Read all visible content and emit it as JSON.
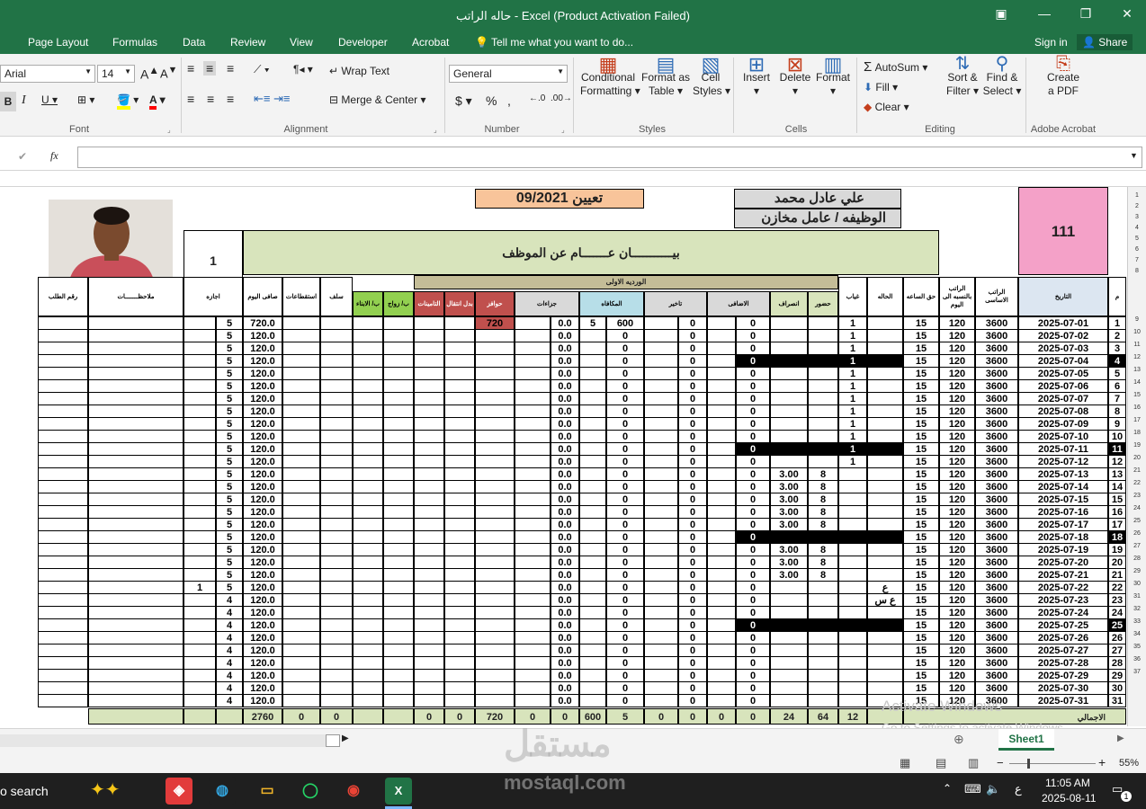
{
  "window": {
    "title": "حاله الراتب - Excel (Product Activation Failed)"
  },
  "menu": [
    "Page Layout",
    "Formulas",
    "Data",
    "Review",
    "View",
    "Developer",
    "Acrobat"
  ],
  "tell_me": "Tell me what you want to do...",
  "sign_in": "Sign in",
  "share": "Share",
  "ribbon": {
    "font_name": "Arial",
    "font_size": "14",
    "number_format": "General",
    "wrap_text": "Wrap Text",
    "merge_center": "Merge & Center",
    "conditional": "Conditional",
    "formatting": "Formatting",
    "format_as": "Format as",
    "table": "Table",
    "cell": "Cell",
    "styles": "Styles",
    "insert": "Insert",
    "delete": "Delete",
    "format": "Format",
    "autosum": "AutoSum",
    "fill": "Fill",
    "clear": "Clear",
    "sort": "Sort &",
    "filter": "Filter",
    "find": "Find &",
    "select": "Select",
    "create": "Create",
    "pdf": "a PDF",
    "groups": {
      "font": "Font",
      "alignment": "Alignment",
      "number": "Number",
      "styles": "Styles",
      "cells": "Cells",
      "editing": "Editing",
      "acrobat": "Adobe Acrobat"
    }
  },
  "formula_bar": {
    "fx": "fx",
    "value": ""
  },
  "sheet": {
    "employee_name": "علي عادل محمد",
    "job": "الوظيفه / عامل مخازن",
    "appointment": "تعيين 09/2021",
    "employee_id": "111",
    "data_title": "بيـــــــــــان عـــــــام عن الموظف",
    "box_one": "1",
    "shift_label": "الورديه الاولى",
    "headers": {
      "m": "م",
      "date": "التاريخ",
      "basic": "الراتب الاساسى",
      "daily": "الراتب بالنسبه الى اليوم",
      "hourly": "حق الساعه",
      "status": "الحاله",
      "absent": "غياب",
      "attend": "حضور",
      "leave": "انصراف",
      "overtime": "الاضافى",
      "late": "تاخير",
      "reward": "المكافاه",
      "penalty": "جزاءات",
      "incentive": "حوافز",
      "allowance": "بدل انتقال",
      "insurance": "التامينات",
      "marriage": "ب/ زواج",
      "kids": "ب/ الابناء",
      "advance": "سلف",
      "deductions": "استقطاعات",
      "net": "صافى اليوم",
      "vacation": "اجازه",
      "notes": "ملاحظـــــــات",
      "request": "رقم الطلب"
    },
    "rows": [
      {
        "n": "1",
        "date": "2025-07-01",
        "absent": "1",
        "attend": "",
        "leave": "",
        "hilite": false,
        "net": "720.0",
        "vac": "5",
        "vac2": "",
        "pen": "0.0",
        "rew": "600",
        "rew2": "5",
        "late": "0",
        "ot": "0",
        "inc": "720",
        "status": ""
      },
      {
        "n": "2",
        "date": "2025-07-02",
        "absent": "1",
        "attend": "",
        "leave": "",
        "hilite": false,
        "net": "120.0",
        "vac": "5",
        "vac2": "",
        "pen": "0.0",
        "rew": "0",
        "rew2": "",
        "late": "0",
        "ot": "0",
        "inc": "",
        "status": ""
      },
      {
        "n": "3",
        "date": "2025-07-03",
        "absent": "1",
        "attend": "",
        "leave": "",
        "hilite": false,
        "net": "120.0",
        "vac": "5",
        "vac2": "",
        "pen": "0.0",
        "rew": "0",
        "rew2": "",
        "late": "0",
        "ot": "0",
        "inc": "",
        "status": ""
      },
      {
        "n": "4",
        "date": "2025-07-04",
        "absent": "1",
        "attend": "",
        "leave": "",
        "hilite": true,
        "net": "120.0",
        "vac": "5",
        "vac2": "",
        "pen": "0.0",
        "rew": "0",
        "rew2": "",
        "late": "0",
        "ot": "0",
        "inc": "",
        "status": ""
      },
      {
        "n": "5",
        "date": "2025-07-05",
        "absent": "1",
        "attend": "",
        "leave": "",
        "hilite": false,
        "net": "120.0",
        "vac": "5",
        "vac2": "",
        "pen": "0.0",
        "rew": "0",
        "rew2": "",
        "late": "0",
        "ot": "0",
        "inc": "",
        "status": ""
      },
      {
        "n": "6",
        "date": "2025-07-06",
        "absent": "1",
        "attend": "",
        "leave": "",
        "hilite": false,
        "net": "120.0",
        "vac": "5",
        "vac2": "",
        "pen": "0.0",
        "rew": "0",
        "rew2": "",
        "late": "0",
        "ot": "0",
        "inc": "",
        "status": ""
      },
      {
        "n": "7",
        "date": "2025-07-07",
        "absent": "1",
        "attend": "",
        "leave": "",
        "hilite": false,
        "net": "120.0",
        "vac": "5",
        "vac2": "",
        "pen": "0.0",
        "rew": "0",
        "rew2": "",
        "late": "0",
        "ot": "0",
        "inc": "",
        "status": ""
      },
      {
        "n": "8",
        "date": "2025-07-08",
        "absent": "1",
        "attend": "",
        "leave": "",
        "hilite": false,
        "net": "120.0",
        "vac": "5",
        "vac2": "",
        "pen": "0.0",
        "rew": "0",
        "rew2": "",
        "late": "0",
        "ot": "0",
        "inc": "",
        "status": ""
      },
      {
        "n": "9",
        "date": "2025-07-09",
        "absent": "1",
        "attend": "",
        "leave": "",
        "hilite": false,
        "net": "120.0",
        "vac": "5",
        "vac2": "",
        "pen": "0.0",
        "rew": "0",
        "rew2": "",
        "late": "0",
        "ot": "0",
        "inc": "",
        "status": ""
      },
      {
        "n": "10",
        "date": "2025-07-10",
        "absent": "1",
        "attend": "",
        "leave": "",
        "hilite": false,
        "net": "120.0",
        "vac": "5",
        "vac2": "",
        "pen": "0.0",
        "rew": "0",
        "rew2": "",
        "late": "0",
        "ot": "0",
        "inc": "",
        "status": ""
      },
      {
        "n": "11",
        "date": "2025-07-11",
        "absent": "1",
        "attend": "",
        "leave": "",
        "hilite": true,
        "net": "120.0",
        "vac": "5",
        "vac2": "",
        "pen": "0.0",
        "rew": "0",
        "rew2": "",
        "late": "0",
        "ot": "0",
        "inc": "",
        "status": ""
      },
      {
        "n": "12",
        "date": "2025-07-12",
        "absent": "1",
        "attend": "",
        "leave": "",
        "hilite": false,
        "net": "120.0",
        "vac": "5",
        "vac2": "",
        "pen": "0.0",
        "rew": "0",
        "rew2": "",
        "late": "0",
        "ot": "0",
        "inc": "",
        "status": ""
      },
      {
        "n": "13",
        "date": "2025-07-13",
        "absent": "",
        "attend": "8",
        "leave": "3.00",
        "hilite": false,
        "net": "120.0",
        "vac": "5",
        "vac2": "",
        "pen": "0.0",
        "rew": "0",
        "rew2": "",
        "late": "0",
        "ot": "0",
        "inc": "",
        "status": ""
      },
      {
        "n": "14",
        "date": "2025-07-14",
        "absent": "",
        "attend": "8",
        "leave": "3.00",
        "hilite": false,
        "net": "120.0",
        "vac": "5",
        "vac2": "",
        "pen": "0.0",
        "rew": "0",
        "rew2": "",
        "late": "0",
        "ot": "0",
        "inc": "",
        "status": ""
      },
      {
        "n": "15",
        "date": "2025-07-15",
        "absent": "",
        "attend": "8",
        "leave": "3.00",
        "hilite": false,
        "net": "120.0",
        "vac": "5",
        "vac2": "",
        "pen": "0.0",
        "rew": "0",
        "rew2": "",
        "late": "0",
        "ot": "0",
        "inc": "",
        "status": ""
      },
      {
        "n": "16",
        "date": "2025-07-16",
        "absent": "",
        "attend": "8",
        "leave": "3.00",
        "hilite": false,
        "net": "120.0",
        "vac": "5",
        "vac2": "",
        "pen": "0.0",
        "rew": "0",
        "rew2": "",
        "late": "0",
        "ot": "0",
        "inc": "",
        "status": ""
      },
      {
        "n": "17",
        "date": "2025-07-17",
        "absent": "",
        "attend": "8",
        "leave": "3.00",
        "hilite": false,
        "net": "120.0",
        "vac": "5",
        "vac2": "",
        "pen": "0.0",
        "rew": "0",
        "rew2": "",
        "late": "0",
        "ot": "0",
        "inc": "",
        "status": ""
      },
      {
        "n": "18",
        "date": "2025-07-18",
        "absent": "",
        "attend": "",
        "leave": "",
        "hilite": true,
        "net": "120.0",
        "vac": "5",
        "vac2": "",
        "pen": "0.0",
        "rew": "0",
        "rew2": "",
        "late": "0",
        "ot": "0",
        "inc": "",
        "status": ""
      },
      {
        "n": "19",
        "date": "2025-07-19",
        "absent": "",
        "attend": "8",
        "leave": "3.00",
        "hilite": false,
        "net": "120.0",
        "vac": "5",
        "vac2": "",
        "pen": "0.0",
        "rew": "0",
        "rew2": "",
        "late": "0",
        "ot": "0",
        "inc": "",
        "status": ""
      },
      {
        "n": "20",
        "date": "2025-07-20",
        "absent": "",
        "attend": "8",
        "leave": "3.00",
        "hilite": false,
        "net": "120.0",
        "vac": "5",
        "vac2": "",
        "pen": "0.0",
        "rew": "0",
        "rew2": "",
        "late": "0",
        "ot": "0",
        "inc": "",
        "status": ""
      },
      {
        "n": "21",
        "date": "2025-07-21",
        "absent": "",
        "attend": "8",
        "leave": "3.00",
        "hilite": false,
        "net": "120.0",
        "vac": "5",
        "vac2": "",
        "pen": "0.0",
        "rew": "0",
        "rew2": "",
        "late": "0",
        "ot": "0",
        "inc": "",
        "status": ""
      },
      {
        "n": "22",
        "date": "2025-07-22",
        "absent": "",
        "attend": "",
        "leave": "",
        "hilite": false,
        "net": "120.0",
        "vac": "5",
        "vac2": "1",
        "pen": "0.0",
        "rew": "0",
        "rew2": "",
        "late": "0",
        "ot": "0",
        "inc": "",
        "status": "ع"
      },
      {
        "n": "23",
        "date": "2025-07-23",
        "absent": "",
        "attend": "",
        "leave": "",
        "hilite": false,
        "net": "120.0",
        "vac": "4",
        "vac2": "",
        "pen": "0.0",
        "rew": "0",
        "rew2": "",
        "late": "0",
        "ot": "0",
        "inc": "",
        "status": "ع س"
      },
      {
        "n": "24",
        "date": "2025-07-24",
        "absent": "",
        "attend": "",
        "leave": "",
        "hilite": false,
        "net": "120.0",
        "vac": "4",
        "vac2": "",
        "pen": "0.0",
        "rew": "0",
        "rew2": "",
        "late": "0",
        "ot": "0",
        "inc": "",
        "status": ""
      },
      {
        "n": "25",
        "date": "2025-07-25",
        "absent": "",
        "attend": "",
        "leave": "",
        "hilite": true,
        "net": "120.0",
        "vac": "4",
        "vac2": "",
        "pen": "0.0",
        "rew": "0",
        "rew2": "",
        "late": "0",
        "ot": "0",
        "inc": "",
        "status": ""
      },
      {
        "n": "26",
        "date": "2025-07-26",
        "absent": "",
        "attend": "",
        "leave": "",
        "hilite": false,
        "net": "120.0",
        "vac": "4",
        "vac2": "",
        "pen": "0.0",
        "rew": "0",
        "rew2": "",
        "late": "0",
        "ot": "0",
        "inc": "",
        "status": ""
      },
      {
        "n": "27",
        "date": "2025-07-27",
        "absent": "",
        "attend": "",
        "leave": "",
        "hilite": false,
        "net": "120.0",
        "vac": "4",
        "vac2": "",
        "pen": "0.0",
        "rew": "0",
        "rew2": "",
        "late": "0",
        "ot": "0",
        "inc": "",
        "status": ""
      },
      {
        "n": "28",
        "date": "2025-07-28",
        "absent": "",
        "attend": "",
        "leave": "",
        "hilite": false,
        "net": "120.0",
        "vac": "4",
        "vac2": "",
        "pen": "0.0",
        "rew": "0",
        "rew2": "",
        "late": "0",
        "ot": "0",
        "inc": "",
        "status": ""
      },
      {
        "n": "29",
        "date": "2025-07-29",
        "absent": "",
        "attend": "",
        "leave": "",
        "hilite": false,
        "net": "120.0",
        "vac": "4",
        "vac2": "",
        "pen": "0.0",
        "rew": "0",
        "rew2": "",
        "late": "0",
        "ot": "0",
        "inc": "",
        "status": ""
      },
      {
        "n": "30",
        "date": "2025-07-30",
        "absent": "",
        "attend": "",
        "leave": "",
        "hilite": false,
        "net": "120.0",
        "vac": "4",
        "vac2": "",
        "pen": "0.0",
        "rew": "0",
        "rew2": "",
        "late": "0",
        "ot": "0",
        "inc": "",
        "status": ""
      },
      {
        "n": "31",
        "date": "2025-07-31",
        "absent": "",
        "attend": "",
        "leave": "",
        "hilite": false,
        "net": "120.0",
        "vac": "4",
        "vac2": "",
        "pen": "0.0",
        "rew": "0",
        "rew2": "",
        "late": "0",
        "ot": "0",
        "inc": "",
        "status": ""
      }
    ],
    "common": {
      "hourly": "15",
      "daily": "120",
      "basic": "3600"
    },
    "totals": {
      "label": "الاجمالي",
      "absent": "12",
      "attend": "64",
      "leave": "24",
      "ot": "0",
      "ot2": "0",
      "late": "0",
      "late2": "0",
      "rew": "5",
      "rew2": "600",
      "pen": "0",
      "pen2": "0",
      "inc": "720",
      "allow": "0",
      "ins": "0",
      "adv": "0",
      "ded": "0",
      "net": "2760"
    },
    "row_numbers": [
      "1",
      "2",
      "3",
      "4",
      "5",
      "6",
      "7",
      "8",
      "9",
      "10",
      "11",
      "12",
      "13",
      "14",
      "15",
      "16",
      "17",
      "18",
      "19",
      "20",
      "21",
      "22",
      "23",
      "24",
      "25",
      "26",
      "27",
      "28",
      "29",
      "30",
      "31",
      "32",
      "33",
      "34",
      "35",
      "36",
      "37"
    ]
  },
  "status": {
    "sheet_tab": "Sheet1",
    "zoom": "55%",
    "watermark1": "Activate Windows",
    "watermark2": "Go to Settings to activate Windows."
  },
  "taskbar": {
    "search": "o search",
    "time": "11:05 AM",
    "date": "2025-08-11",
    "lang": "ع",
    "notif": "1"
  },
  "brand": {
    "name": "مستقل",
    "site": "mostaql.com"
  }
}
